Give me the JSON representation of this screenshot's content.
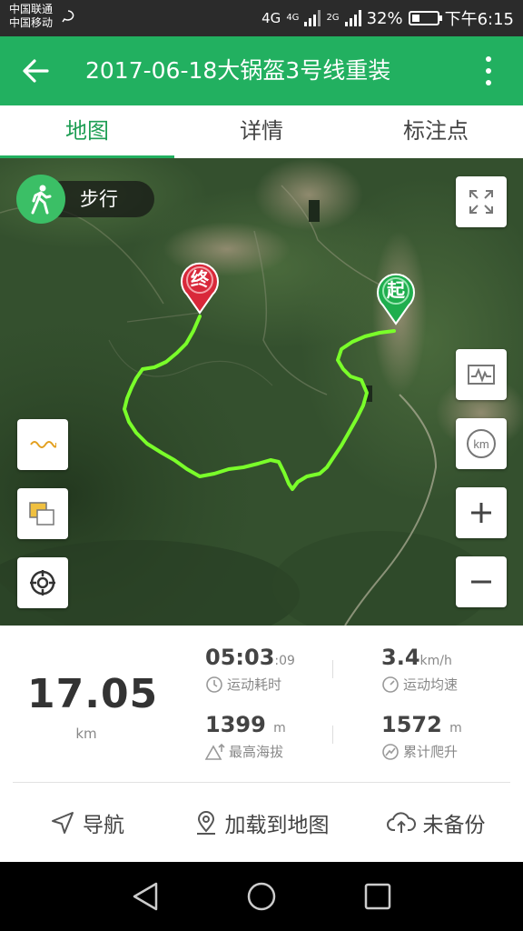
{
  "status": {
    "carrier1": "中国联通",
    "carrier2": "中国移动",
    "net1": "4G",
    "net2": "4G",
    "net3": "2G",
    "battery": "32%",
    "battery_level": 0.32,
    "time": "下午6:15"
  },
  "appbar": {
    "title": "2017-06-18大锅盔3号线重装"
  },
  "tabs": [
    "地图",
    "详情",
    "标注点"
  ],
  "map": {
    "mode_label": "步行",
    "end_marker": "终",
    "start_marker": "起",
    "track_color": "#7aff2a"
  },
  "stats": {
    "distance": "17.05",
    "distance_unit": "km",
    "duration_main": "05:03",
    "duration_sec": ":09",
    "duration_label": "运动耗时",
    "speed": "3.4",
    "speed_unit": "km/h",
    "speed_label": "运动均速",
    "max_alt": "1399",
    "max_alt_unit": "m",
    "max_alt_label": "最高海拔",
    "climb": "1572",
    "climb_unit": "m",
    "climb_label": "累计爬升"
  },
  "actions": {
    "navigate": "导航",
    "load_map": "加载到地图",
    "backup": "未备份"
  },
  "colors": {
    "primary": "#22b060",
    "end": "#d9283a",
    "start": "#1fae4e"
  }
}
